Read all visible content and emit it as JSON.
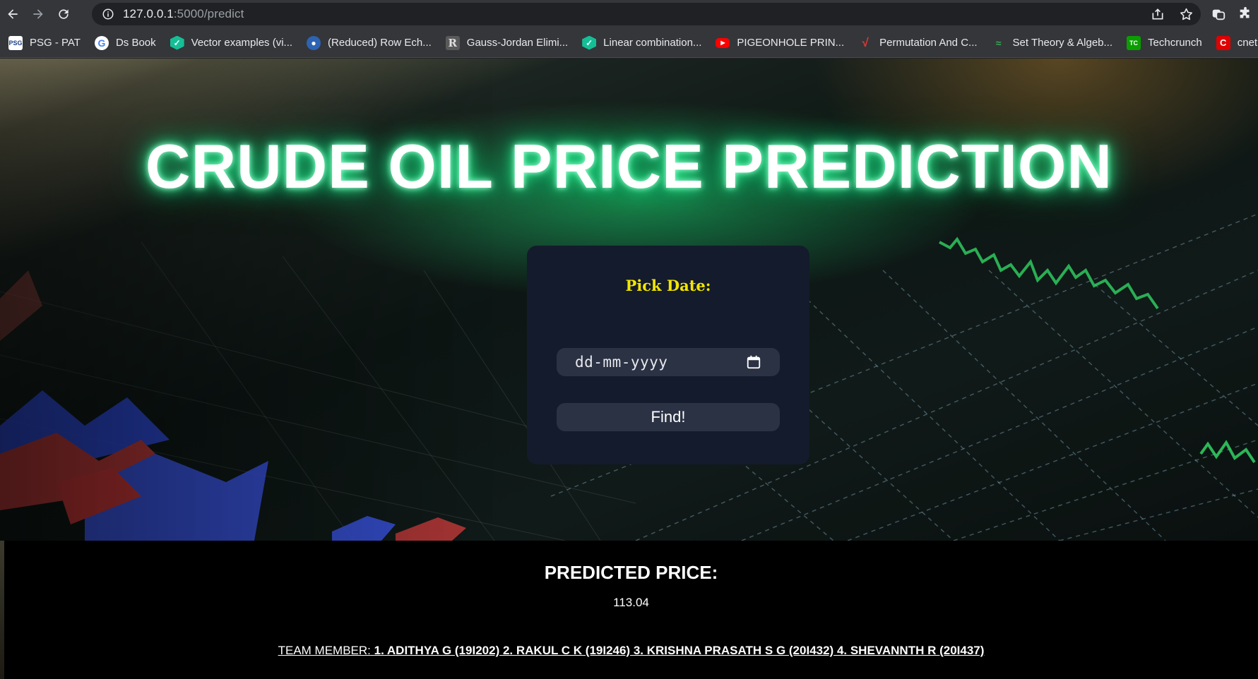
{
  "browser": {
    "url_host": "127.0.0.1",
    "url_path": ":5000/predict"
  },
  "bookmarks": [
    {
      "label": "PSG - PAT",
      "icon": "psg-icon",
      "color": "#ffffff"
    },
    {
      "label": "Ds Book",
      "icon": "google-icon",
      "color": "#ffffff"
    },
    {
      "label": "Vector examples (vi...",
      "icon": "khan-academy-icon",
      "color": "#14bf96"
    },
    {
      "label": "(Reduced) Row Ech...",
      "icon": "sympy-icon",
      "color": "#2c63b3"
    },
    {
      "label": "Gauss-Jordan Elimi...",
      "icon": "r-icon",
      "color": "#c8c8c8"
    },
    {
      "label": "Linear combination...",
      "icon": "khan-academy-icon",
      "color": "#14bf96"
    },
    {
      "label": "PIGEONHOLE PRIN...",
      "icon": "youtube-icon",
      "color": "#ff0000"
    },
    {
      "label": "Permutation And C...",
      "icon": "math-icon",
      "color": "#e53935"
    },
    {
      "label": "Set Theory & Algeb...",
      "icon": "set-theory-icon",
      "color": "#3aa655"
    },
    {
      "label": "Techcrunch",
      "icon": "techcrunch-icon",
      "color": "#0a9e01"
    },
    {
      "label": "cnet",
      "icon": "cnet-icon",
      "color": "#e00000"
    }
  ],
  "hero": {
    "title": "CRUDE OIL PRICE PREDICTION"
  },
  "form": {
    "label": "Pick Date:",
    "date_placeholder": "dd-mm-yyyy",
    "button_label": "Find!"
  },
  "result": {
    "title": "PREDICTED PRICE:",
    "value": "113.04",
    "team_lead": "TEAM MEMBER:",
    "team_names": "1. ADITHYA G (19I202) 2. RAKUL C K (19I246) 3. KRISHNA PRASATH S G (20I432) 4. SHEVANNTH R (20I437)"
  },
  "colors": {
    "label_yellow": "#f2e600",
    "card_bg": "#141b2c",
    "glow_green": "#2cff9a"
  }
}
